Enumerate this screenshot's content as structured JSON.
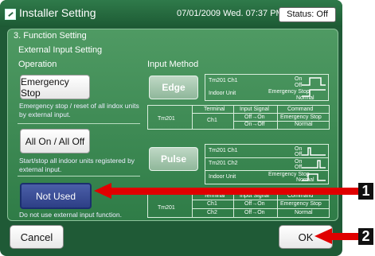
{
  "header": {
    "title": "Installer Setting",
    "datetime": "07/01/2009 Wed. 07:37 PM",
    "status": "Status: Off"
  },
  "section": {
    "title": "3. Function Setting",
    "subtitle": "External Input Setting",
    "operation_label": "Operation",
    "input_method_label": "Input Method"
  },
  "operations": {
    "emergency_stop": {
      "label": "Emergency Stop",
      "desc": "Emergency stop / reset of all indox units by external input."
    },
    "all_on_off": {
      "label": "All On / All Off",
      "desc": "Start/stop all indoor units registered by external input."
    },
    "not_used": {
      "label": "Not Used",
      "desc": "Do not use external input function."
    }
  },
  "methods": {
    "edge": {
      "label": "Edge",
      "row1": "Tm201  Ch1",
      "row2": "Indoor Unit",
      "on": "On",
      "off": "Off",
      "state": "Emergency Stop",
      "normal": "Normal",
      "table": {
        "terminal": "Terminal",
        "input": "Input Signal",
        "command": "Command",
        "tm": "Tm201",
        "ch": "Ch1",
        "sig1": "Off→On",
        "cmd1": "Emergency Stop",
        "sig2": "On→Off",
        "cmd2": "Normal"
      }
    },
    "pulse": {
      "label": "Pulse",
      "row1": "Tm201  Ch1",
      "row2": "Tm201  Ch2",
      "row3": "Indoor Unit",
      "on": "On",
      "off": "Off",
      "state": "Emergency Stop",
      "normal": "Normal",
      "table": {
        "terminal": "Terminal",
        "input": "Input Signal",
        "command": "Command",
        "tm": "Tm201",
        "ch1": "Ch1",
        "sig1": "Off→On",
        "cmd1": "Emergency Stop",
        "ch2": "Ch2",
        "sig2": "Off→On",
        "cmd2": "Normal"
      }
    }
  },
  "buttons": {
    "cancel": "Cancel",
    "ok": "OK"
  },
  "callouts": {
    "one": "1",
    "two": "2"
  },
  "colors": {
    "frame": "#1f5a36",
    "panel": "#3f8c55",
    "selected": "#2d3f86",
    "callout_arrow": "#e00000"
  }
}
